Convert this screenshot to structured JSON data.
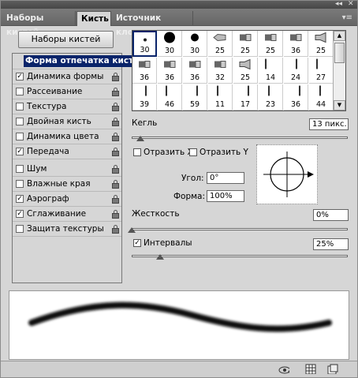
{
  "window": {
    "collapse_glyph": "◂◂",
    "close_glyph": "✕",
    "menu_glyph": "▾≡"
  },
  "tabs": [
    {
      "label": "Наборы кистей",
      "active": false
    },
    {
      "label": "Кисть",
      "active": true
    },
    {
      "label": "Источник клонов",
      "active": false
    }
  ],
  "presets_button": "Наборы кистей",
  "options": [
    {
      "label": "Форма отпечатка кисти",
      "checked": null,
      "selected": true,
      "lock": false
    },
    {
      "label": "Динамика формы",
      "checked": true,
      "lock": true
    },
    {
      "label": "Рассеивание",
      "checked": false,
      "lock": true
    },
    {
      "label": "Текстура",
      "checked": false,
      "lock": true
    },
    {
      "label": "Двойная кисть",
      "checked": false,
      "lock": true
    },
    {
      "label": "Динамика цвета",
      "checked": false,
      "lock": true
    },
    {
      "label": "Передача",
      "checked": true,
      "lock": true
    },
    {
      "label": "Шум",
      "checked": false,
      "lock": true
    },
    {
      "label": "Влажные края",
      "checked": false,
      "lock": true
    },
    {
      "label": "Аэрограф",
      "checked": true,
      "lock": true
    },
    {
      "label": "Сглаживание",
      "checked": true,
      "lock": true
    },
    {
      "label": "Защита текстуры",
      "checked": false,
      "lock": true
    }
  ],
  "brush_tips": [
    {
      "size": "1",
      "kind": "hard"
    },
    {
      "size": "30",
      "kind": "hard"
    },
    {
      "size": "30",
      "kind": "hard"
    },
    {
      "size": "25",
      "kind": "pencil"
    },
    {
      "size": "25",
      "kind": "marker"
    },
    {
      "size": "25",
      "kind": "marker"
    },
    {
      "size": "36",
      "kind": "marker"
    },
    {
      "size": "25",
      "kind": "fan"
    },
    {
      "size": "36",
      "kind": "marker"
    },
    {
      "size": "36",
      "kind": "marker"
    },
    {
      "size": "36",
      "kind": "marker"
    },
    {
      "size": "32",
      "kind": "marker"
    },
    {
      "size": "25",
      "kind": "fan"
    },
    {
      "size": "14",
      "kind": "splatter"
    },
    {
      "size": "24",
      "kind": "splatter"
    },
    {
      "size": "27",
      "kind": "splatter"
    },
    {
      "size": "39",
      "kind": "splatter"
    },
    {
      "size": "46",
      "kind": "splatter"
    },
    {
      "size": "59",
      "kind": "splatter"
    },
    {
      "size": "11",
      "kind": "splatter"
    },
    {
      "size": "17",
      "kind": "splatter"
    },
    {
      "size": "23",
      "kind": "splatter"
    },
    {
      "size": "36",
      "kind": "splatter"
    },
    {
      "size": "44",
      "kind": "splatter"
    }
  ],
  "brush_tip_numbers_visible": [
    "30",
    "30",
    "30",
    "25",
    "25",
    "25",
    "36",
    "25",
    "36",
    "36",
    "36",
    "32",
    "25",
    "14",
    "24",
    "27",
    "39",
    "46",
    "59",
    "11",
    "17",
    "23",
    "36",
    "44"
  ],
  "size": {
    "label": "Кегль",
    "value": "13 пикс.",
    "fraction": 0.04
  },
  "flip_x": {
    "label": "Отразить X",
    "checked": false
  },
  "flip_y": {
    "label": "Отразить Y",
    "checked": false
  },
  "angle": {
    "label": "Угол:",
    "value": "0°"
  },
  "roundness": {
    "label": "Форма:",
    "value": "100%"
  },
  "hardness": {
    "label": "Жесткость",
    "value": "0%",
    "fraction": 0.0
  },
  "spacing": {
    "label": "Интервалы",
    "value": "25%",
    "checked": true,
    "fraction": 0.13
  },
  "icons": {
    "bottom": [
      "eye-brush-icon",
      "grid-icon",
      "new-preset-icon"
    ],
    "lock": "lock-icon"
  }
}
